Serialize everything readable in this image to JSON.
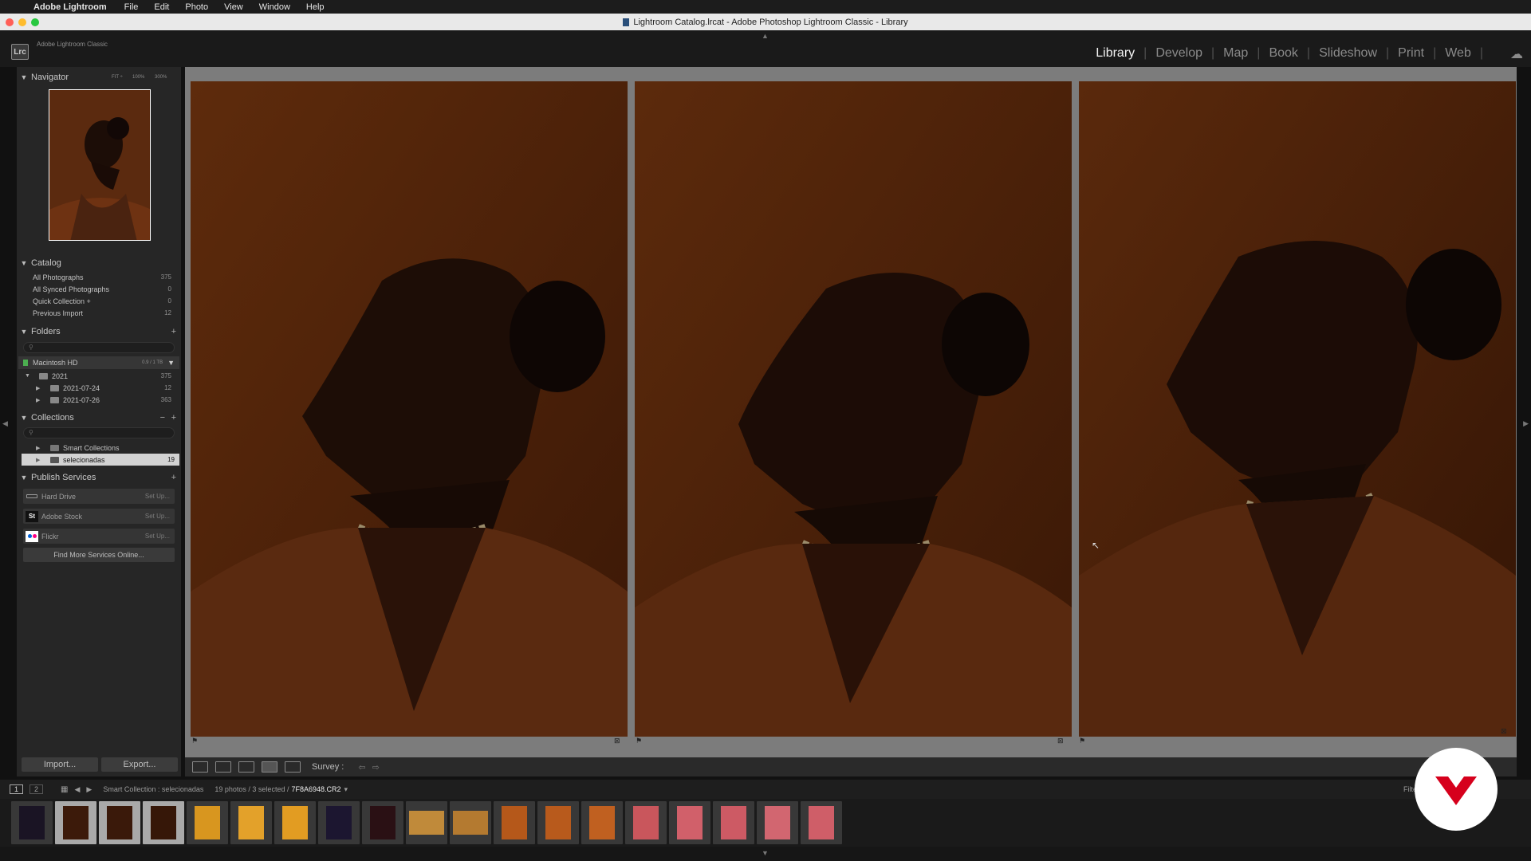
{
  "menubar": {
    "app_name": "Adobe Lightroom",
    "items": [
      "File",
      "Edit",
      "Photo",
      "View",
      "Window",
      "Help"
    ]
  },
  "window": {
    "title": "Lightroom Catalog.lrcat - Adobe Photoshop Lightroom Classic - Library"
  },
  "identity": {
    "badge": "Lrc",
    "brand": "Adobe Lightroom Classic"
  },
  "modules": [
    "Library",
    "Develop",
    "Map",
    "Book",
    "Slideshow",
    "Print",
    "Web"
  ],
  "navigator": {
    "title": "Navigator",
    "zoom_options": [
      "FIT ÷",
      "100%",
      "300%"
    ]
  },
  "catalog": {
    "title": "Catalog",
    "items": [
      {
        "label": "All Photographs",
        "count": "375"
      },
      {
        "label": "All Synced Photographs",
        "count": "0"
      },
      {
        "label": "Quick Collection +",
        "count": "0"
      },
      {
        "label": "Previous Import",
        "count": "12"
      }
    ]
  },
  "folders": {
    "title": "Folders",
    "volume": {
      "label": "Macintosh HD",
      "usage": "0.9 / 1 TB"
    },
    "items": [
      {
        "label": "2021",
        "count": "375"
      },
      {
        "label": "2021-07-24",
        "count": "12"
      },
      {
        "label": "2021-07-26",
        "count": "363"
      }
    ]
  },
  "collections": {
    "title": "Collections",
    "items": [
      {
        "label": "Smart Collections",
        "count": ""
      },
      {
        "label": "selecionadas",
        "count": "19"
      }
    ]
  },
  "publish": {
    "title": "Publish Services",
    "items": [
      {
        "label": "Hard Drive",
        "action": "Set Up..."
      },
      {
        "label": "Adobe Stock",
        "action": "Set Up...",
        "icon": "St"
      },
      {
        "label": "Flickr",
        "action": "Set Up..."
      }
    ],
    "find_more": "Find More Services Online..."
  },
  "buttons": {
    "import": "Import...",
    "export": "Export..."
  },
  "toolbar": {
    "mode": "Survey :"
  },
  "filmstrip": {
    "page1": "1",
    "page2": "2",
    "source": "Smart Collection : selecionadas",
    "info": "19 photos / 3 selected /",
    "filename": "7F8A6948.CR2",
    "filter": "Filter"
  },
  "colors": {
    "accent_red": "#d6001c",
    "background": "#7c7c7c",
    "panel": "#262626"
  }
}
